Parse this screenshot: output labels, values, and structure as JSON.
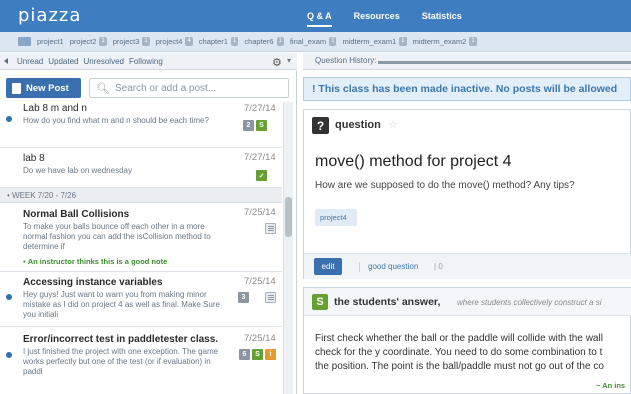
{
  "app": {
    "logo": "piazza"
  },
  "topnav": [
    {
      "label": "Q & A",
      "active": true
    },
    {
      "label": "Resources",
      "active": false
    },
    {
      "label": "Statistics",
      "active": false
    }
  ],
  "folders": [
    {
      "label": "project1",
      "count": ""
    },
    {
      "label": "project2",
      "count": "1"
    },
    {
      "label": "project3",
      "count": "1"
    },
    {
      "label": "project4",
      "count": "4"
    },
    {
      "label": "chapter1",
      "count": "1"
    },
    {
      "label": "chapter6",
      "count": "1"
    },
    {
      "label": "final_exam",
      "count": "1"
    },
    {
      "label": "midterm_exam1",
      "count": "1"
    },
    {
      "label": "midterm_exam2",
      "count": "1"
    }
  ],
  "filters": [
    "Unread",
    "Updated",
    "Unresolved",
    "Following"
  ],
  "question_history": {
    "label": "Question History:"
  },
  "new_post": {
    "label": "New Post"
  },
  "search": {
    "placeholder": "Search or add a post..."
  },
  "feed": {
    "week_header": "• WEEK 7/20 - 7/26",
    "items": [
      {
        "title": "Lab 8 m and n",
        "body": "How do you find what m and n should be each time?",
        "date": "7/27/14",
        "unread": true,
        "badges": [
          {
            "type": "gray",
            "text": "2"
          },
          {
            "type": "green",
            "text": "S"
          }
        ]
      },
      {
        "title": "lab 8",
        "body": "Do we have lab on wednesday",
        "date": "7/27/14",
        "unread": false,
        "badges": [
          {
            "type": "green",
            "text": "✓"
          }
        ]
      },
      {
        "title": "Normal Ball Collisions",
        "body": "To make your balls bounce off each other in a more normal fashion you can add the isCollision method to determine if",
        "instructor_note": "An instructor thinks this is a good note",
        "date": "7/25/14",
        "unread": false,
        "badges": [
          {
            "type": "note",
            "text": ""
          }
        ]
      },
      {
        "title": "Accessing instance variables",
        "body": "Hey guys! Just want to warn you from making minor mistake as I did on project 4 as well as final. Make Sure you initiali",
        "date": "7/25/14",
        "unread": true,
        "badges": [
          {
            "type": "gray",
            "text": "3"
          },
          {
            "type": "note",
            "text": ""
          }
        ]
      },
      {
        "title": "Error/incorrect test in paddletester class.",
        "body": "I just finished the project with one exception. The game works perfectly but one of the test (or if evaluation) in paddl",
        "date": "7/25/14",
        "unread": true,
        "badges": [
          {
            "type": "gray",
            "text": "6"
          },
          {
            "type": "green",
            "text": "S"
          },
          {
            "type": "orange",
            "text": "i"
          }
        ]
      }
    ]
  },
  "notice": "! This class has been made inactive. No posts will be allowed",
  "question": {
    "label": "question",
    "title": "move() method for project 4",
    "body": "How are we supposed to do the move() method? Any tips?",
    "tag": "project4",
    "edit_label": "edit",
    "good_question_label": "good question",
    "good_question_count": "0"
  },
  "answer": {
    "icon": "S",
    "label": "the students' answer,",
    "subtitle": "where students collectively construct a si",
    "lines": [
      "First check whether the ball or the paddle will collide with the wall",
      "check for the y coordinate. You need to do some combination to t",
      "the position. The point is the ball/paddle must not go out of the co"
    ],
    "signature": "~ An ins"
  },
  "colors": {
    "brand_blue": "#3e7dbf",
    "unread_dot": "#2f6fb5",
    "student_green": "#66a032",
    "instructor_orange": "#e39b2b"
  }
}
